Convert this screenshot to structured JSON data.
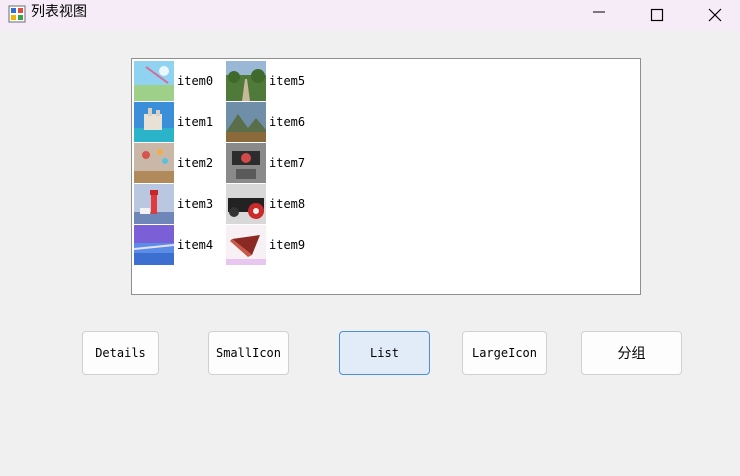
{
  "window": {
    "title": "列表视图"
  },
  "listview": {
    "items": [
      {
        "label": "item0",
        "thumb": "sky-field-photo"
      },
      {
        "label": "item1",
        "thumb": "castle-sea-photo"
      },
      {
        "label": "item2",
        "thumb": "balloons-sky-photo"
      },
      {
        "label": "item3",
        "thumb": "lighthouse-photo"
      },
      {
        "label": "item4",
        "thumb": "purple-coast-photo"
      },
      {
        "label": "item5",
        "thumb": "forest-path-photo"
      },
      {
        "label": "item6",
        "thumb": "mountain-valley-photo"
      },
      {
        "label": "item7",
        "thumb": "car-interior-photo"
      },
      {
        "label": "item8",
        "thumb": "red-wheel-car-photo"
      },
      {
        "label": "item9",
        "thumb": "cake-slice-photo"
      }
    ]
  },
  "buttons": {
    "details": "Details",
    "smallicon": "SmallIcon",
    "list": "List",
    "largeicon": "LargeIcon",
    "group": "分组"
  }
}
